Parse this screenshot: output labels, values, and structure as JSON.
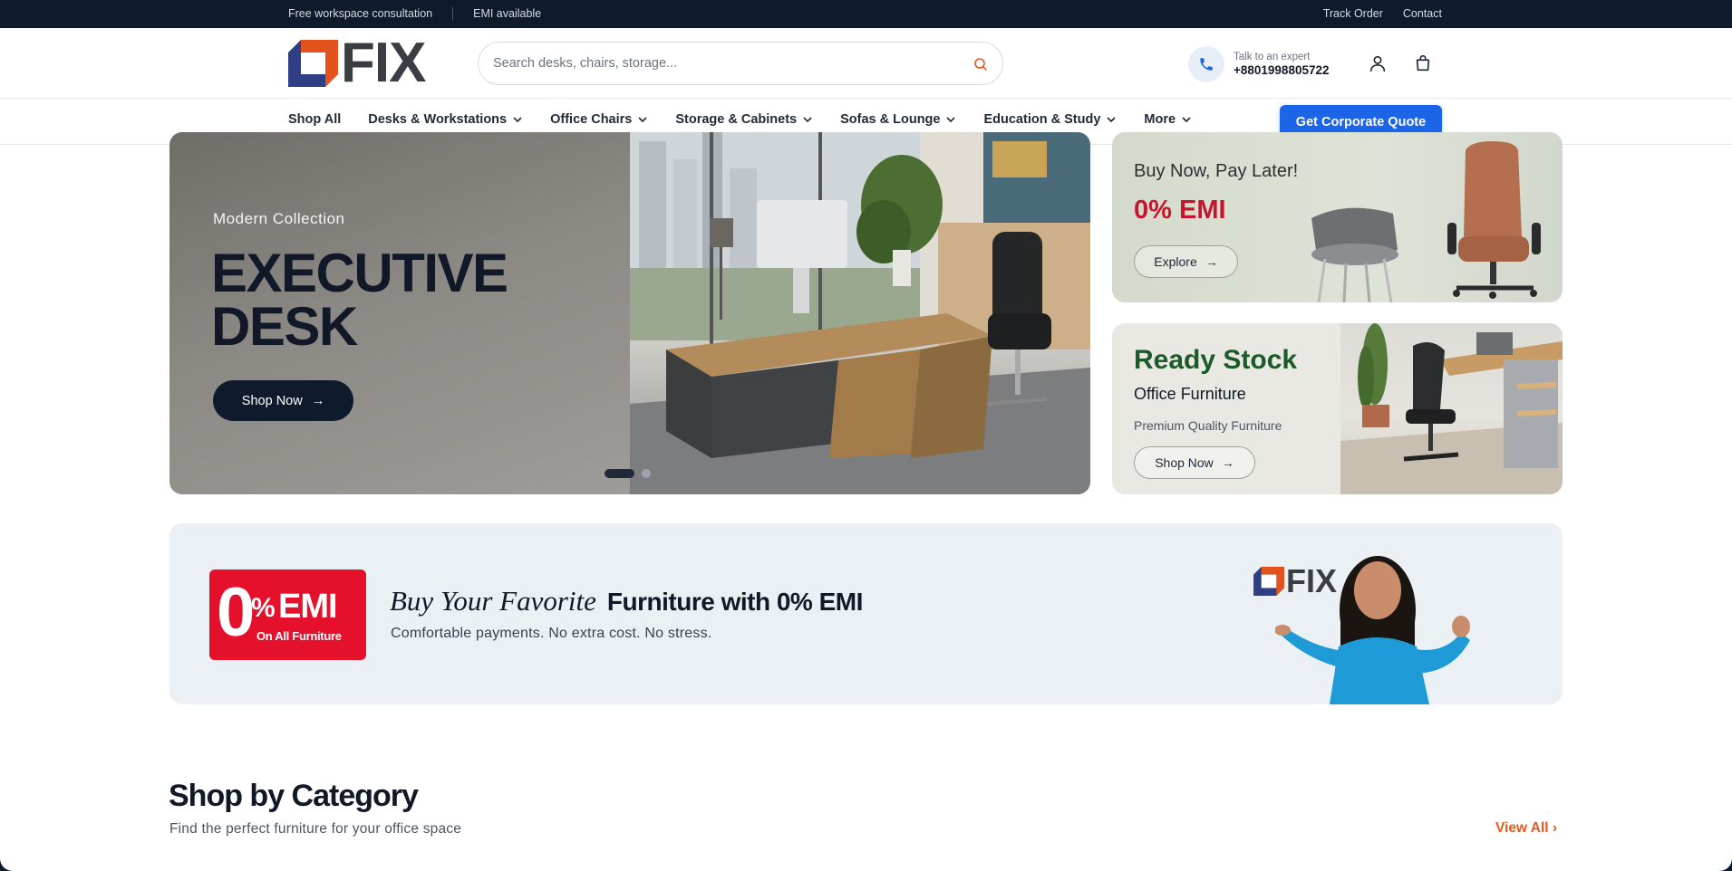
{
  "topbar": {
    "left_items": [
      "Free workspace consultation",
      "EMI available"
    ],
    "track_order": "Track Order",
    "contact": "Contact"
  },
  "header": {
    "logo_text": "FIX",
    "search_placeholder": "Search desks, chairs, storage...",
    "expert_label": "Talk to an expert",
    "expert_phone": "+8801998805722",
    "icons": [
      "search-icon",
      "phone-icon",
      "user-icon",
      "cart-icon"
    ]
  },
  "nav": {
    "items": [
      {
        "label": "Shop All",
        "dropdown": false
      },
      {
        "label": "Desks & Workstations",
        "dropdown": true
      },
      {
        "label": "Office Chairs",
        "dropdown": true
      },
      {
        "label": "Storage & Cabinets",
        "dropdown": true
      },
      {
        "label": "Sofas & Lounge",
        "dropdown": true
      },
      {
        "label": "Education & Study",
        "dropdown": true
      },
      {
        "label": "More",
        "dropdown": true
      }
    ],
    "quote_button": "Get Corporate Quote"
  },
  "hero": {
    "eyebrow": "Modern Collection",
    "title_line1": "EXECUTIVE",
    "title_line2": "DESK",
    "button": "Shop Now",
    "slides": 2,
    "active_slide": 1
  },
  "promo_emi": {
    "line1": "Buy Now, Pay Later!",
    "line2": "0% EMI",
    "button": "Explore"
  },
  "promo_stock": {
    "title": "Ready Stock",
    "subtitle": "Office Furniture",
    "caption": "Premium Quality Furniture",
    "button": "Shop Now"
  },
  "emi_banner": {
    "badge_zero": "0",
    "badge_pct": "%",
    "badge_emi": "EMI",
    "badge_sub": "On All Furniture",
    "headline_italic": "Buy Your Favorite",
    "headline_bold": "Furniture with 0% EMI",
    "subtext": "Comfortable payments. No extra cost. No stress.",
    "logo_text": "FIX"
  },
  "category": {
    "title": "Shop by Category",
    "subtitle": "Find the perfect furniture for your office space",
    "view_all": "View All ›"
  },
  "colors": {
    "navy": "#0f1b2d",
    "primary_blue": "#1c64e8",
    "emi_red": "#c8152e",
    "stock_green": "#1c5a2a",
    "accent_orange": "#e35b1e"
  }
}
